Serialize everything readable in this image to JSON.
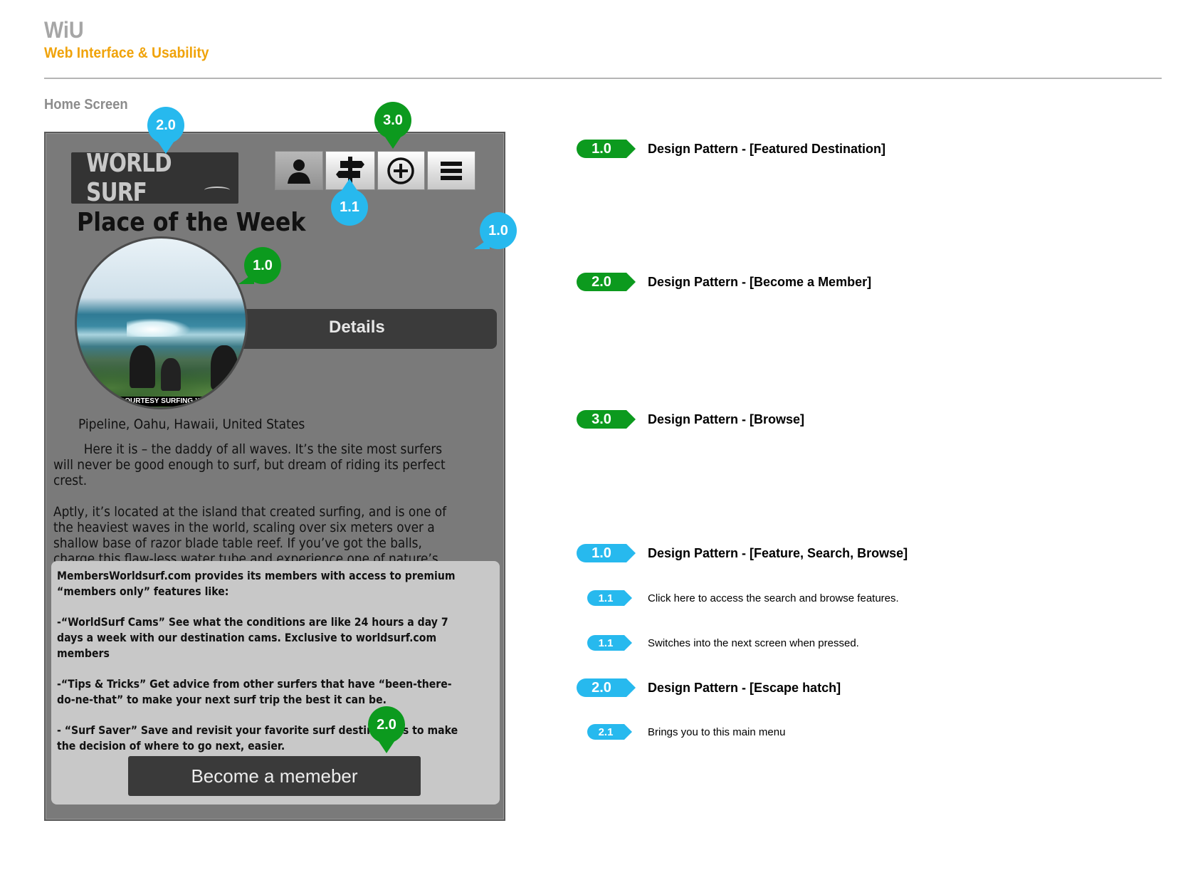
{
  "header": {
    "brand": "WiU",
    "subtitle": "Web Interface & Usability",
    "section": "Home Screen"
  },
  "mockup": {
    "logo_text": "WORLD SURF",
    "nav_icons": [
      "user-icon",
      "signpost-icon",
      "add-circle-icon",
      "menu-icon"
    ],
    "place_title": "Place of the Week",
    "details_label": "Details",
    "photo_credit": "COURTESY SURFING-WAVES",
    "location": "Pipeline, Oahu, Hawaii, United States",
    "description_1": "Here it is – the daddy of all waves. It’s the site most surfers will never be good enough to surf, but dream of riding its perfect crest.",
    "description_2": "Aptly, it’s located at the island that created surfing, and is one of the heaviest waves in the world, scaling over six meters over a shallow base of razor blade table reef. If you’ve got the balls, charge this flaw-less water tube and experience one of nature’s finest creations.",
    "members_intro": "MembersWorldsurf.com provides its members with access to premium “members only” features like:",
    "members_cams": "-“WorldSurf Cams” See what the conditions are like 24 hours a day 7 days a week with our destination cams. Exclusive to worldsurf.com members",
    "members_tips": "-“Tips & Tricks” Get advice from other surfers that have “been-there-do-ne-that” to make your next surf trip the best it can be.",
    "members_saver": "- “Surf Saver” Save and revisit your favorite surf destinations to make the decision of where to go next, easier.",
    "join_label": "Become a memeber"
  },
  "markers": {
    "logo": "2.0",
    "browse": "3.0",
    "nav": "1.1",
    "side": "1.0",
    "photo": "1.0",
    "join": "2.0"
  },
  "legend": [
    {
      "tag": "1.0",
      "label": "Design Pattern - [Featured Destination]"
    },
    {
      "tag": "2.0",
      "label": "Design Pattern - [Become a Member]"
    },
    {
      "tag": "3.0",
      "label": "Design Pattern - [Browse]"
    },
    {
      "tag": "1.0",
      "label": "Design Pattern - [Feature, Search, Browse]"
    },
    {
      "tag": "1.1",
      "label": "Click here to access the search and browse features."
    },
    {
      "tag": "1.1",
      "label": "Switches into the next screen when pressed."
    },
    {
      "tag": "2.0",
      "label": "Design Pattern - [Escape hatch]"
    },
    {
      "tag": "2.1",
      "label": "Brings you to this main menu"
    }
  ],
  "colors": {
    "accent": "#f0a30a",
    "marker_blue": "#27b9ee",
    "marker_green": "#0c9a1e",
    "mockup_bg": "#7a7a7a"
  }
}
